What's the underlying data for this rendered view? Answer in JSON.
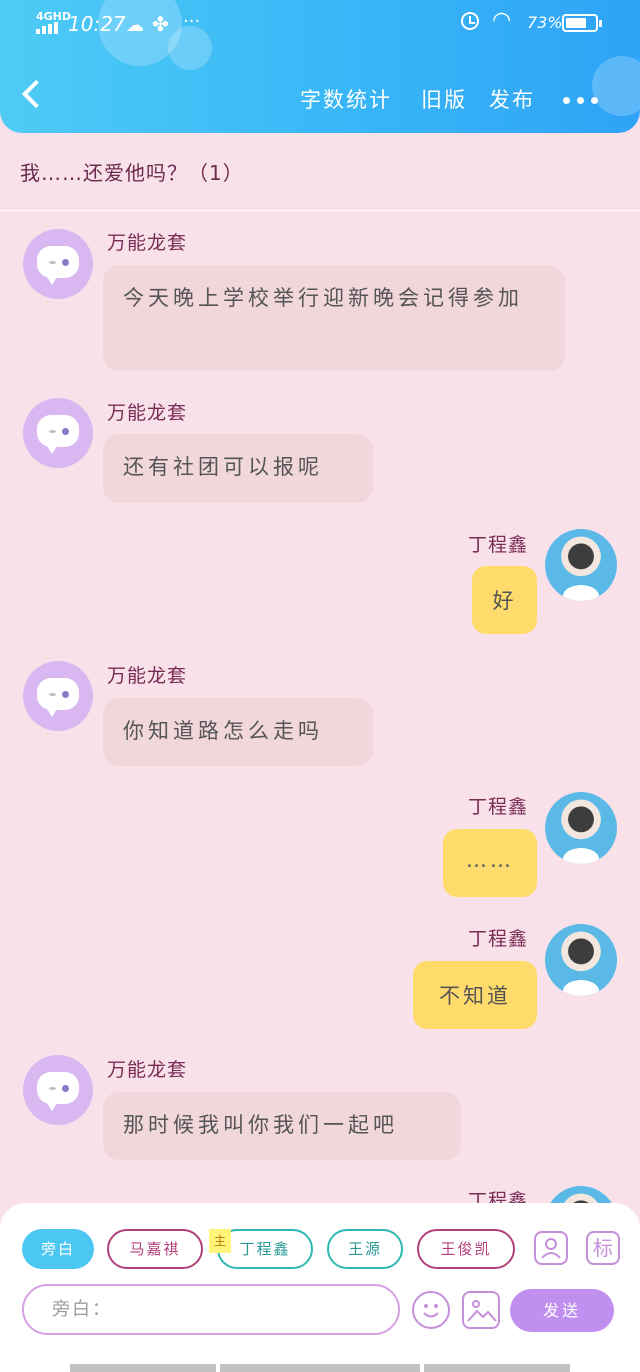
{
  "status_bar": {
    "network": "4GHD",
    "time": "10:27",
    "more": "···",
    "battery_text": "73%",
    "battery_level": 0.73
  },
  "header": {
    "back_icon": "chevron-left-icon",
    "actions": [
      "字数统计",
      "旧版",
      "发布"
    ],
    "menu_icon": "more-dots-icon",
    "gradient": [
      "#4ecbf5",
      "#2fa3f6"
    ]
  },
  "chapter": {
    "title": "我……还爱他吗？（1）"
  },
  "messages": [
    {
      "side": "left",
      "sender": "万能龙套",
      "text": "今天晚上学校举行迎新晚会记得参加"
    },
    {
      "side": "left",
      "sender": "万能龙套",
      "text": "还有社团可以报呢"
    },
    {
      "side": "right",
      "sender": "丁程鑫",
      "text": "好"
    },
    {
      "side": "left",
      "sender": "万能龙套",
      "text": "你知道路怎么走吗"
    },
    {
      "side": "right",
      "sender": "丁程鑫",
      "text": "……"
    },
    {
      "side": "right",
      "sender": "丁程鑫",
      "text": "不知道"
    },
    {
      "side": "left",
      "sender": "万能龙套",
      "text": "那时候我叫你我们一起吧"
    },
    {
      "side": "right",
      "sender": "丁程鑫",
      "text": ""
    }
  ],
  "composer": {
    "chips": [
      "旁白",
      "马嘉祺",
      "丁程鑫",
      "王源",
      "王俊凯"
    ],
    "main_tag": "主",
    "role_icon": "person-card-icon",
    "tag_icon_label": "标",
    "input_placeholder": "旁白：",
    "emoji_icon": "smile-icon",
    "image_icon": "image-icon",
    "send_label": "发送"
  },
  "colors": {
    "page_background": "#f9e1ea",
    "bubble_left": "#f1d7db",
    "bubble_right": "#fedb6b",
    "sender_name": "#7a2d55",
    "send_button": "#c08ff0"
  }
}
